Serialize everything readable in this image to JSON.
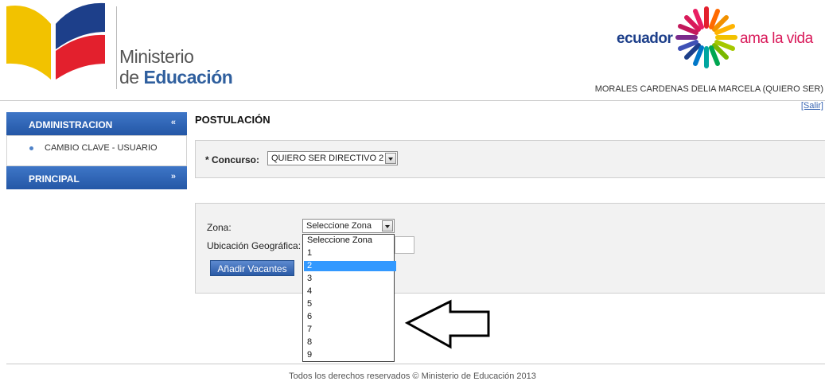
{
  "header": {
    "ministry_line1": "Ministerio",
    "ministry_line2_prefix": "de ",
    "ministry_line2_bold": "Educación",
    "brand_left": "ecuador",
    "brand_right": "ama la vida",
    "user_name": "MORALES CARDENAS DELIA MARCELA (QUIERO SER)",
    "logout": "[Salir]"
  },
  "sidebar": {
    "sections": [
      {
        "label": "ADMINISTRACION",
        "chevron": "«",
        "expanded": true
      },
      {
        "label": "PRINCIPAL",
        "chevron": "»",
        "expanded": false
      }
    ],
    "items": [
      {
        "label": "CAMBIO CLAVE - USUARIO"
      }
    ]
  },
  "main": {
    "title": "POSTULACIÓN",
    "concurso_label": "* Concurso:",
    "concurso_value": "QUIERO SER DIRECTIVO 2",
    "zona_label": "Zona:",
    "zona_value": "Seleccione Zona",
    "ubicacion_label": "Ubicación Geográfica:",
    "add_button": "Añadir Vacantes",
    "zona_options": [
      "Seleccione Zona",
      "1",
      "2",
      "3",
      "4",
      "5",
      "6",
      "7",
      "8",
      "9"
    ],
    "zona_highlighted": "2"
  },
  "footer": {
    "text": "Todos los derechos reservados © Ministerio de Educación 2013"
  },
  "colors": {
    "sidebar_header": "#2f65b5",
    "brand_blue": "#1d3f8a",
    "brand_pink": "#d91a5a",
    "highlight": "#3399ff"
  },
  "icons": [
    "ministry-logo-icon",
    "ecuador-sun-icon",
    "chevron-up-icon",
    "chevron-down-icon",
    "dropdown-arrow-icon",
    "arrow-annotation-icon"
  ]
}
